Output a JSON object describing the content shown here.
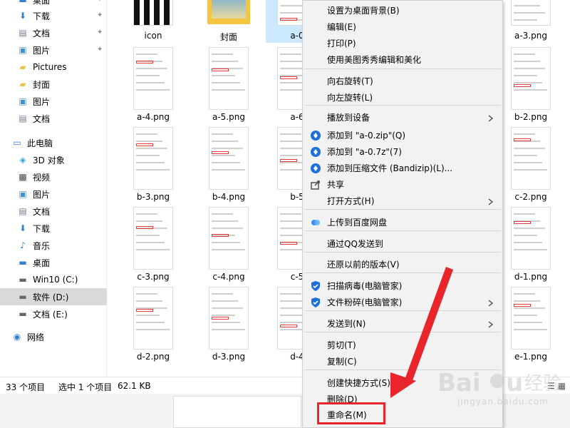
{
  "sidebar": {
    "items": [
      {
        "label": "桌面",
        "icon": "desktop-icon",
        "pinned": true
      },
      {
        "label": "下载",
        "icon": "download-icon",
        "pinned": true
      },
      {
        "label": "文档",
        "icon": "documents-icon",
        "pinned": true
      },
      {
        "label": "图片",
        "icon": "pictures-icon",
        "pinned": true
      },
      {
        "label": "Pictures",
        "icon": "folder-icon",
        "pinned": false
      },
      {
        "label": "封面",
        "icon": "folder-icon",
        "pinned": false
      },
      {
        "label": "图片",
        "icon": "pictures-icon",
        "pinned": false
      },
      {
        "label": "文档",
        "icon": "documents-icon",
        "pinned": false
      },
      {
        "label": "此电脑",
        "icon": "computer-icon",
        "pinned": false
      },
      {
        "label": "3D 对象",
        "icon": "3d-objects-icon",
        "pinned": false
      },
      {
        "label": "视频",
        "icon": "video-icon",
        "pinned": false
      },
      {
        "label": "图片",
        "icon": "pictures-icon",
        "pinned": false
      },
      {
        "label": "文档",
        "icon": "documents-icon",
        "pinned": false
      },
      {
        "label": "下载",
        "icon": "download-icon",
        "pinned": false
      },
      {
        "label": "音乐",
        "icon": "music-icon",
        "pinned": false
      },
      {
        "label": "桌面",
        "icon": "desktop-icon",
        "pinned": false
      },
      {
        "label": "Win10 (C:)",
        "icon": "drive-icon",
        "pinned": false
      },
      {
        "label": "软件 (D:)",
        "icon": "drive-icon",
        "pinned": false,
        "selected": true
      },
      {
        "label": "文档 (E:)",
        "icon": "drive-icon",
        "pinned": false
      },
      {
        "label": "网络",
        "icon": "network-icon",
        "pinned": false
      }
    ]
  },
  "files": [
    {
      "name": "icon"
    },
    {
      "name": "封面"
    },
    {
      "name": "a-0",
      "selected": true
    },
    {
      "name": "a-3.png"
    },
    {
      "name": "a-4.png"
    },
    {
      "name": "a-5.png"
    },
    {
      "name": "a-6"
    },
    {
      "name": "b-2.png"
    },
    {
      "name": "b-3.png"
    },
    {
      "name": "b-4.png"
    },
    {
      "name": "b-5"
    },
    {
      "name": "c-2.png"
    },
    {
      "name": "c-3.png"
    },
    {
      "name": "c-4.png"
    },
    {
      "name": "c-5"
    },
    {
      "name": "d-1.png"
    },
    {
      "name": "d-2.png"
    },
    {
      "name": "d-3.png"
    },
    {
      "name": "d-4"
    },
    {
      "name": "e-1.png"
    }
  ],
  "statusbar": {
    "count": "33 个项目",
    "selection": "选中 1 个项目",
    "size": "62.1 KB"
  },
  "context_menu": {
    "items": [
      {
        "label": "设置为桌面背景(B)"
      },
      {
        "label": "编辑(E)"
      },
      {
        "label": "打印(P)"
      },
      {
        "label": "使用美图秀秀编辑和美化"
      },
      {
        "label": "向右旋转(T)"
      },
      {
        "label": "向左旋转(L)"
      },
      {
        "label": "播放到设备",
        "submenu": true
      },
      {
        "label": "添加到 \"a-0.zip\"(Q)",
        "icon": "bandizip-icon"
      },
      {
        "label": "添加到 \"a-0.7z\"(7)",
        "icon": "bandizip-icon"
      },
      {
        "label": "添加到压缩文件 (Bandizip)(L)...",
        "icon": "bandizip-icon"
      },
      {
        "label": "共享",
        "icon": "share-icon"
      },
      {
        "label": "打开方式(H)",
        "submenu": true
      },
      {
        "label": "上传到百度网盘",
        "icon": "baidu-netdisk-icon"
      },
      {
        "label": "通过QQ发送到"
      },
      {
        "label": "还原以前的版本(V)"
      },
      {
        "label": "扫描病毒(电脑管家)",
        "icon": "tencent-shield-icon"
      },
      {
        "label": "文件粉碎(电脑管家)",
        "icon": "tencent-shield-icon",
        "submenu": true
      },
      {
        "label": "发送到(N)",
        "submenu": true
      },
      {
        "label": "剪切(T)"
      },
      {
        "label": "复制(C)"
      },
      {
        "label": "创建快捷方式(S)"
      },
      {
        "label": "删除(D)"
      },
      {
        "label": "重命名(M)",
        "highlighted": true
      }
    ]
  },
  "watermark": {
    "text": "jingyan.baidu.com"
  },
  "colors": {
    "annotation_red": "#e8252b",
    "selection_blue": "#cce8ff",
    "menu_bg": "#f2f2f2"
  }
}
